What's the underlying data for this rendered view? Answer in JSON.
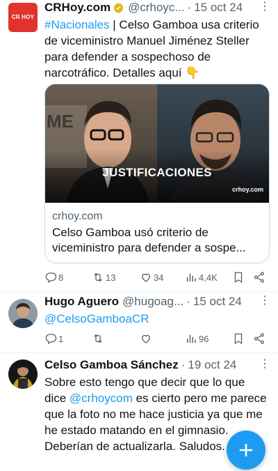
{
  "tweets": [
    {
      "display_name": "CRHoy.com",
      "handle": "@crhoyc...",
      "dot": "·",
      "date": "15 oct 24",
      "more": "⋮",
      "avatar_text": "CR HOY",
      "body": {
        "hashtag": "#Nacionales",
        "text": " | Celso Gamboa usa criterio de viceministro Manuel Jiménez Steller para defender a sospechoso de narcotráfico. Detalles aquí 👇"
      },
      "card": {
        "image_caption": "JUSTIFICACIONES",
        "image_watermark": "crhoy.com",
        "domain": "crhoy.com",
        "title": "Celso Gamboa usó criterio de viceministro para defender a sospe..."
      },
      "stats": {
        "replies": "8",
        "retweets": "13",
        "likes": "34",
        "views": "4,4K"
      }
    },
    {
      "display_name": "Hugo Aguero",
      "handle": "@hugoag...",
      "dot": "·",
      "date": "15 oct 24",
      "more": "⋮",
      "body": {
        "mention": "@CelsoGamboaCR"
      },
      "stats": {
        "replies": "1",
        "retweets": "",
        "likes": "",
        "views": "96"
      }
    },
    {
      "display_name": "Celso Gamboa Sánchez",
      "dot": "·",
      "date": "19 oct 24",
      "more": "⋮",
      "body": {
        "text_before": "Sobre esto tengo que decir que lo que dice ",
        "mention": "@crhoycom",
        "text_after": " es cierto pero me parece que la foto no me hace justicia ya que me he estado matando en el gimnasio. Deberían de actualizarla. Saludos."
      }
    }
  ],
  "colors": {
    "accent": "#1d9bf0",
    "muted": "#536471",
    "text": "#0f1419",
    "brand_red": "#e0332d",
    "border": "#cfd9de"
  },
  "icons": [
    "verified-badge-icon",
    "reply-icon",
    "retweet-icon",
    "like-icon",
    "views-icon",
    "bookmark-icon",
    "share-icon",
    "compose-plus-icon"
  ]
}
